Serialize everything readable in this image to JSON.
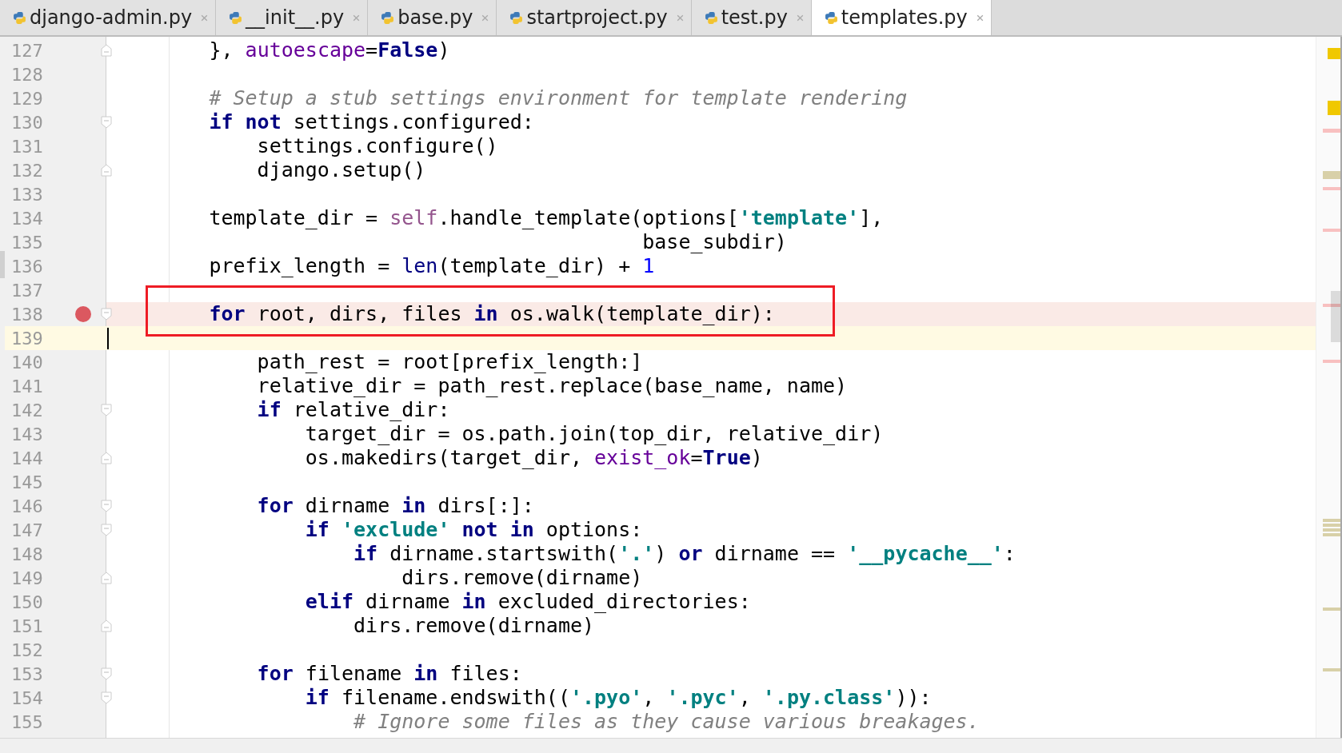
{
  "tabs": [
    {
      "label": "django-admin.py",
      "selected": false
    },
    {
      "label": "__init__.py",
      "selected": false
    },
    {
      "label": "base.py",
      "selected": false
    },
    {
      "label": "startproject.py",
      "selected": false
    },
    {
      "label": "test.py",
      "selected": false
    },
    {
      "label": "templates.py",
      "selected": true
    }
  ],
  "editor": {
    "lines": [
      {
        "number": "127",
        "kind": "fold-end",
        "breakpoint": false,
        "current": false,
        "annotated": false,
        "tokens": [
          {
            "kind": "plain",
            "t": "        }, "
          },
          {
            "kind": "kwarg",
            "t": "autoescape"
          },
          {
            "kind": "plain",
            "t": "="
          },
          {
            "kind": "kw",
            "t": "False"
          },
          {
            "kind": "plain",
            "t": ")"
          }
        ]
      },
      {
        "number": "128",
        "kind": "plain",
        "breakpoint": false,
        "current": false,
        "annotated": false
      },
      {
        "number": "129",
        "kind": "plain",
        "breakpoint": false,
        "current": false,
        "annotated": false,
        "tokens": [
          {
            "kind": "comment",
            "t": "        # Setup a stub settings environment for template rendering"
          }
        ]
      },
      {
        "number": "130",
        "kind": "fold-start",
        "breakpoint": false,
        "current": false,
        "annotated": false,
        "tokens": [
          {
            "kind": "kw",
            "t": "        if not"
          },
          {
            "kind": "plain",
            "t": " settings.configured:"
          }
        ]
      },
      {
        "number": "131",
        "kind": "plain",
        "breakpoint": false,
        "current": false,
        "annotated": false,
        "tokens": [
          {
            "kind": "plain",
            "t": "            settings.configure()"
          }
        ]
      },
      {
        "number": "132",
        "kind": "fold-end",
        "breakpoint": false,
        "current": false,
        "annotated": false,
        "tokens": [
          {
            "kind": "plain",
            "t": "            django.setup()"
          }
        ]
      },
      {
        "number": "133",
        "kind": "plain",
        "breakpoint": false,
        "current": false,
        "annotated": false
      },
      {
        "number": "134",
        "kind": "plain",
        "breakpoint": false,
        "current": false,
        "annotated": false,
        "tokens": [
          {
            "kind": "plain",
            "t": "        template_dir = "
          },
          {
            "kind": "self",
            "t": "self"
          },
          {
            "kind": "plain",
            "t": ".handle_template(options["
          },
          {
            "kind": "str",
            "t": "'template'"
          },
          {
            "kind": "plain",
            "t": "],"
          }
        ]
      },
      {
        "number": "135",
        "kind": "plain",
        "breakpoint": false,
        "current": false,
        "annotated": false,
        "tokens": [
          {
            "kind": "plain",
            "t": "                                            base_subdir)"
          }
        ]
      },
      {
        "number": "136",
        "kind": "plain",
        "breakpoint": false,
        "current": false,
        "annotated": false,
        "tokens": [
          {
            "kind": "plain",
            "t": "        prefix_length = "
          },
          {
            "kind": "builtin",
            "t": "len"
          },
          {
            "kind": "plain",
            "t": "(template_dir) + "
          },
          {
            "kind": "num",
            "t": "1"
          }
        ]
      },
      {
        "number": "137",
        "kind": "plain",
        "breakpoint": false,
        "current": false,
        "annotated": false
      },
      {
        "number": "138",
        "kind": "fold-start",
        "breakpoint": true,
        "current": false,
        "annotated": true,
        "tokens": [
          {
            "kind": "kw",
            "t": "        for"
          },
          {
            "kind": "plain",
            "t": " root, dirs, files "
          },
          {
            "kind": "kw",
            "t": "in"
          },
          {
            "kind": "plain",
            "t": " os.walk(template_dir):"
          }
        ]
      },
      {
        "number": "139",
        "kind": "plain",
        "breakpoint": false,
        "current": true,
        "annotated": false
      },
      {
        "number": "140",
        "kind": "plain",
        "breakpoint": false,
        "current": false,
        "annotated": false,
        "tokens": [
          {
            "kind": "plain",
            "t": "            path_rest = root[prefix_length:]"
          }
        ]
      },
      {
        "number": "141",
        "kind": "plain",
        "breakpoint": false,
        "current": false,
        "annotated": false,
        "tokens": [
          {
            "kind": "plain",
            "t": "            relative_dir = path_rest.replace(base_name, name)"
          }
        ]
      },
      {
        "number": "142",
        "kind": "fold-start",
        "breakpoint": false,
        "current": false,
        "annotated": false,
        "tokens": [
          {
            "kind": "kw",
            "t": "            if"
          },
          {
            "kind": "plain",
            "t": " relative_dir:"
          }
        ]
      },
      {
        "number": "143",
        "kind": "plain",
        "breakpoint": false,
        "current": false,
        "annotated": false,
        "tokens": [
          {
            "kind": "plain",
            "t": "                target_dir = os.path.join(top_dir, relative_dir)"
          }
        ]
      },
      {
        "number": "144",
        "kind": "fold-end",
        "breakpoint": false,
        "current": false,
        "annotated": false,
        "tokens": [
          {
            "kind": "plain",
            "t": "                os.makedirs(target_dir, "
          },
          {
            "kind": "kwarg",
            "t": "exist_ok"
          },
          {
            "kind": "plain",
            "t": "="
          },
          {
            "kind": "kw",
            "t": "True"
          },
          {
            "kind": "plain",
            "t": ")"
          }
        ]
      },
      {
        "number": "145",
        "kind": "plain",
        "breakpoint": false,
        "current": false,
        "annotated": false
      },
      {
        "number": "146",
        "kind": "fold-start",
        "breakpoint": false,
        "current": false,
        "annotated": false,
        "tokens": [
          {
            "kind": "kw",
            "t": "            for"
          },
          {
            "kind": "plain",
            "t": " dirname "
          },
          {
            "kind": "kw",
            "t": "in"
          },
          {
            "kind": "plain",
            "t": " dirs[:]:"
          }
        ]
      },
      {
        "number": "147",
        "kind": "fold-start",
        "breakpoint": false,
        "current": false,
        "annotated": false,
        "tokens": [
          {
            "kind": "kw",
            "t": "                if "
          },
          {
            "kind": "str",
            "t": "'exclude'"
          },
          {
            "kind": "kw",
            "t": " not in"
          },
          {
            "kind": "plain",
            "t": " options:"
          }
        ]
      },
      {
        "number": "148",
        "kind": "plain",
        "breakpoint": false,
        "current": false,
        "annotated": false,
        "tokens": [
          {
            "kind": "kw",
            "t": "                    if"
          },
          {
            "kind": "plain",
            "t": " dirname.startswith("
          },
          {
            "kind": "str",
            "t": "'.'"
          },
          {
            "kind": "plain",
            "t": ") "
          },
          {
            "kind": "kw",
            "t": "or"
          },
          {
            "kind": "plain",
            "t": " dirname == "
          },
          {
            "kind": "str",
            "t": "'__pycache__'"
          },
          {
            "kind": "plain",
            "t": ":"
          }
        ]
      },
      {
        "number": "149",
        "kind": "fold-end",
        "breakpoint": false,
        "current": false,
        "annotated": false,
        "tokens": [
          {
            "kind": "plain",
            "t": "                        dirs.remove(dirname)"
          }
        ]
      },
      {
        "number": "150",
        "kind": "plain",
        "breakpoint": false,
        "current": false,
        "annotated": false,
        "tokens": [
          {
            "kind": "kw",
            "t": "                elif"
          },
          {
            "kind": "plain",
            "t": " dirname "
          },
          {
            "kind": "kw",
            "t": "in"
          },
          {
            "kind": "plain",
            "t": " excluded_directories:"
          }
        ]
      },
      {
        "number": "151",
        "kind": "fold-end",
        "breakpoint": false,
        "current": false,
        "annotated": false,
        "tokens": [
          {
            "kind": "plain",
            "t": "                    dirs.remove(dirname)"
          }
        ]
      },
      {
        "number": "152",
        "kind": "plain",
        "breakpoint": false,
        "current": false,
        "annotated": false
      },
      {
        "number": "153",
        "kind": "fold-start",
        "breakpoint": false,
        "current": false,
        "annotated": false,
        "tokens": [
          {
            "kind": "kw",
            "t": "            for"
          },
          {
            "kind": "plain",
            "t": " filename "
          },
          {
            "kind": "kw",
            "t": "in"
          },
          {
            "kind": "plain",
            "t": " files:"
          }
        ]
      },
      {
        "number": "154",
        "kind": "fold-start",
        "breakpoint": false,
        "current": false,
        "annotated": false,
        "tokens": [
          {
            "kind": "kw",
            "t": "                if"
          },
          {
            "kind": "plain",
            "t": " filename.endswith(("
          },
          {
            "kind": "str",
            "t": "'.pyo'"
          },
          {
            "kind": "plain",
            "t": ", "
          },
          {
            "kind": "str",
            "t": "'.pyc'"
          },
          {
            "kind": "plain",
            "t": ", "
          },
          {
            "kind": "str",
            "t": "'.py.class'"
          },
          {
            "kind": "plain",
            "t": ")):"
          }
        ]
      },
      {
        "number": "155",
        "kind": "plain",
        "breakpoint": false,
        "current": false,
        "annotated": false,
        "tokens": [
          {
            "kind": "comment",
            "t": "                    # Ignore some files as they cause various breakages."
          }
        ]
      }
    ]
  }
}
